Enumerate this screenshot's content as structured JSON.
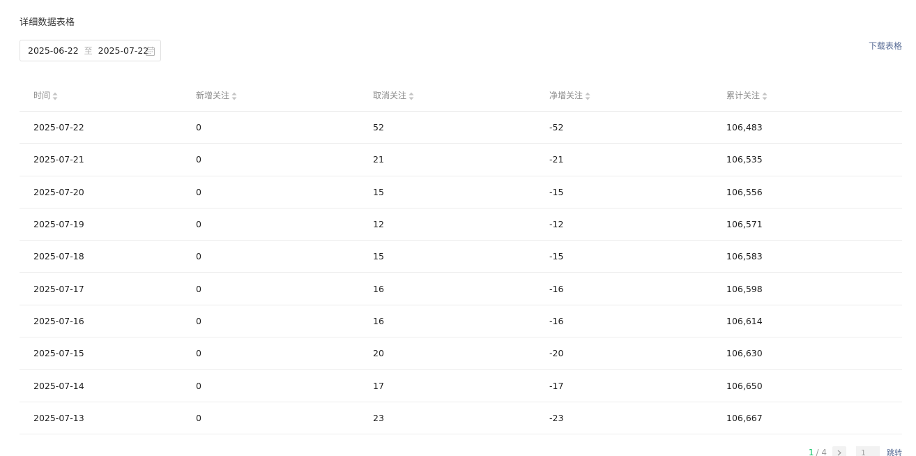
{
  "section_title": "详细数据表格",
  "date_range": {
    "start": "2025-06-22",
    "separator": "至",
    "end": "2025-07-22"
  },
  "download_label": "下载表格",
  "table": {
    "headers": [
      "时间",
      "新增关注",
      "取消关注",
      "净增关注",
      "累计关注"
    ],
    "rows": [
      [
        "2025-07-22",
        "0",
        "52",
        "-52",
        "106,483"
      ],
      [
        "2025-07-21",
        "0",
        "21",
        "-21",
        "106,535"
      ],
      [
        "2025-07-20",
        "0",
        "15",
        "-15",
        "106,556"
      ],
      [
        "2025-07-19",
        "0",
        "12",
        "-12",
        "106,571"
      ],
      [
        "2025-07-18",
        "0",
        "15",
        "-15",
        "106,583"
      ],
      [
        "2025-07-17",
        "0",
        "16",
        "-16",
        "106,598"
      ],
      [
        "2025-07-16",
        "0",
        "16",
        "-16",
        "106,614"
      ],
      [
        "2025-07-15",
        "0",
        "20",
        "-20",
        "106,630"
      ],
      [
        "2025-07-14",
        "0",
        "17",
        "-17",
        "106,650"
      ],
      [
        "2025-07-13",
        "0",
        "23",
        "-23",
        "106,667"
      ]
    ]
  },
  "pagination": {
    "current": "1",
    "total": "/ 4",
    "next_icon": "chevron-right-icon",
    "input_value": "1",
    "jump_label": "跳转"
  },
  "colors": {
    "accent": "#07c160",
    "link": "#576b95"
  }
}
